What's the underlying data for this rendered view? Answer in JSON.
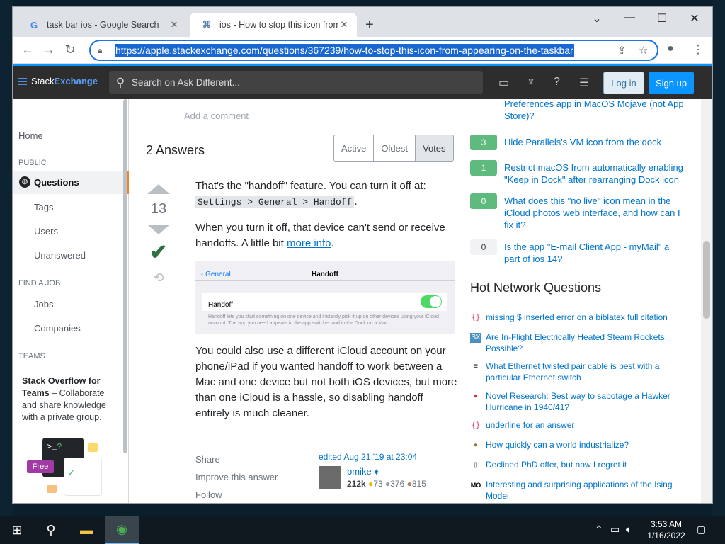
{
  "browser": {
    "tabs": [
      {
        "title": "task bar ios - Google Search",
        "favicon": "G"
      },
      {
        "title": "ios - How to stop this icon from a",
        "favicon": "⌘"
      }
    ],
    "url": "https://apple.stackexchange.com/questions/367239/how-to-stop-this-icon-from-appearing-on-the-taskbar"
  },
  "se": {
    "logo_stack": "Stack",
    "logo_exchange": "Exchange",
    "search_placeholder": "Search on Ask Different...",
    "login": "Log in",
    "signup": "Sign up"
  },
  "leftnav": {
    "home": "Home",
    "public": "PUBLIC",
    "questions": "Questions",
    "tags": "Tags",
    "users": "Users",
    "unanswered": "Unanswered",
    "find_job": "FIND A JOB",
    "jobs": "Jobs",
    "companies": "Companies",
    "teams": "TEAMS",
    "teams_title": "Stack Overflow for Teams",
    "teams_text": " – Collaborate and share knowledge with a private group.",
    "free": "Free"
  },
  "main": {
    "add_comment": "Add a comment",
    "answers_heading": "2 Answers",
    "sort": [
      "Active",
      "Oldest",
      "Votes"
    ],
    "votes": "13",
    "p1_text": "That's the \"handoff\" feature. You can turn it off at:",
    "p1_code": "Settings > General > Handoff",
    "p2_text": "When you turn it off, that device can't send or receive handoffs. A little bit ",
    "p2_link": "more info",
    "img_back": "General",
    "img_title": "Handoff",
    "img_row": "Handoff",
    "img_desc": "Handoff lets you start something on one device and instantly pick it up on other devices using your iCloud account. The app you need appears in the app switcher and in the Dock on a Mac.",
    "p3_text": "You could also use a different iCloud account on your phone/iPad if you wanted handoff to work between a Mac and one device but not both iOS devices, but more than one iCloud is a hassle, so disabling handoff entirely is much cleaner.",
    "share": "Share",
    "improve": "Improve this answer",
    "follow": "Follow",
    "edited": "edited Aug 21 '19 at 23:04",
    "user": "bmike",
    "rep": "212k",
    "gold": "73",
    "silver": "376",
    "bronze": "815"
  },
  "sidebar": {
    "top_partial": "Preferences app in MacOS Mojave (not App Store)?",
    "related": [
      {
        "score": "3",
        "title": "Hide Parallels's VM icon from the dock",
        "answered": true
      },
      {
        "score": "1",
        "title": "Restrict macOS from automatically enabling \"Keep in Dock\" after rearranging Dock icon",
        "answered": true
      },
      {
        "score": "0",
        "title": "What does this \"no live\" icon mean in the iCloud photos web interface, and how can I fix it?",
        "answered": true
      },
      {
        "score": "0",
        "title": "Is the app \"E-mail Client App - myMail\" a part of ios 14?",
        "answered": false
      }
    ],
    "hnq_heading": "Hot Network Questions",
    "hnq": [
      {
        "icon": "{ }",
        "title": "missing $ inserted error on a biblatex full citation"
      },
      {
        "icon": "SX",
        "title": "Are In-Flight Electrically Heated Steam Rockets Possible?"
      },
      {
        "icon": "≡",
        "title": "What Ethernet twisted pair cable is best with a particular Ethernet switch"
      },
      {
        "icon": "●",
        "title": "Novel Research: Best way to sabotage a Hawker Hurricane in 1940/41?"
      },
      {
        "icon": "{ }",
        "title": "underline for an answer"
      },
      {
        "icon": "●",
        "title": "How quickly can a world industrialize?"
      },
      {
        "icon": "▯",
        "title": "Declined PhD offer, but now I regret it"
      },
      {
        "icon": "MO",
        "title": "Interesting and surprising applications of the Ising Model"
      }
    ]
  },
  "taskbar": {
    "time": "3:53 AM",
    "date": "1/16/2022"
  }
}
